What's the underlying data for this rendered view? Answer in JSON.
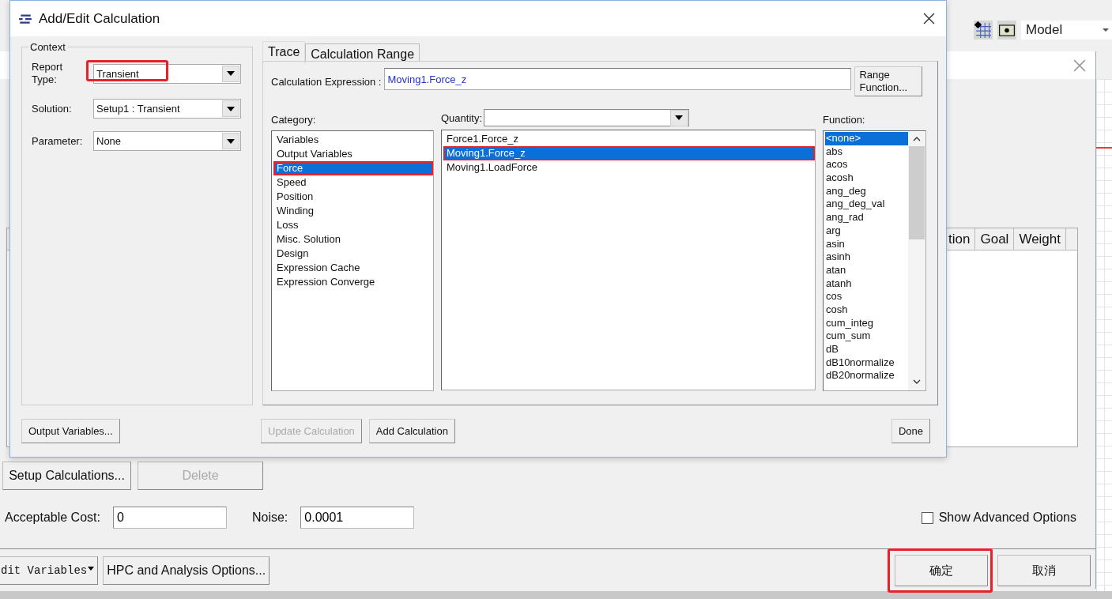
{
  "app": {
    "view_dropdown": "Model"
  },
  "setup_window": {
    "table": {
      "columns": [
        "tion",
        "Goal",
        "Weight"
      ]
    },
    "actions": [
      {
        "label": "Setup Calculations...",
        "disabled": false
      },
      {
        "label": "Delete",
        "disabled": true
      }
    ],
    "fields": [
      {
        "label": "Acceptable Cost:",
        "value": "0"
      },
      {
        "label": "Noise:",
        "value": "0.0001"
      }
    ],
    "advanced_option": {
      "label": "Show Advanced Options",
      "checked": false
    },
    "footer_buttons": [
      {
        "label": "dit Variables",
        "kind": "menu"
      },
      {
        "label": "HPC and Analysis Options...",
        "kind": "plain"
      }
    ],
    "dialog_buttons": [
      {
        "label": "确定",
        "highlighted": true
      },
      {
        "label": "取消",
        "highlighted": false
      }
    ]
  },
  "dialog": {
    "title": "Add/Edit Calculation",
    "context": {
      "legend": "Context",
      "fields": [
        {
          "label": "Report Type:",
          "value": "Transient",
          "highlighted": true
        },
        {
          "label": "Solution:",
          "value": "Setup1 : Transient",
          "highlighted": false
        },
        {
          "label": "Parameter:",
          "value": "None",
          "highlighted": false
        }
      ]
    },
    "output_variables_button": "Output Variables...",
    "tabs": [
      {
        "label": "Trace",
        "selected": true
      },
      {
        "label": "Calculation Range",
        "selected": false
      }
    ],
    "expression": {
      "label": "Calculation Expression :",
      "value": "Moving1.Force_z"
    },
    "range_function_button": "Range Function...",
    "category": {
      "label": "Category:",
      "items": [
        {
          "label": "Variables",
          "selected": false,
          "highlighted": false
        },
        {
          "label": "Output Variables",
          "selected": false,
          "highlighted": false
        },
        {
          "label": "Force",
          "selected": true,
          "highlighted": true
        },
        {
          "label": "Speed",
          "selected": false,
          "highlighted": false
        },
        {
          "label": "Position",
          "selected": false,
          "highlighted": false
        },
        {
          "label": "Winding",
          "selected": false,
          "highlighted": false
        },
        {
          "label": "Loss",
          "selected": false,
          "highlighted": false
        },
        {
          "label": "Misc. Solution",
          "selected": false,
          "highlighted": false
        },
        {
          "label": "Design",
          "selected": false,
          "highlighted": false
        },
        {
          "label": "Expression Cache",
          "selected": false,
          "highlighted": false
        },
        {
          "label": "Expression Converge",
          "selected": false,
          "highlighted": false
        }
      ]
    },
    "quantity": {
      "label": "Quantity:",
      "items": [
        {
          "label": "Force1.Force_z",
          "selected": false,
          "highlighted": false
        },
        {
          "label": "Moving1.Force_z",
          "selected": true,
          "highlighted": true
        },
        {
          "label": "Moving1.LoadForce",
          "selected": false,
          "highlighted": false
        }
      ]
    },
    "function": {
      "label": "Function:",
      "items": [
        {
          "label": "<none>",
          "selected": true
        },
        {
          "label": "abs",
          "selected": false
        },
        {
          "label": "acos",
          "selected": false
        },
        {
          "label": "acosh",
          "selected": false
        },
        {
          "label": "ang_deg",
          "selected": false
        },
        {
          "label": "ang_deg_val",
          "selected": false
        },
        {
          "label": "ang_rad",
          "selected": false
        },
        {
          "label": "arg",
          "selected": false
        },
        {
          "label": "asin",
          "selected": false
        },
        {
          "label": "asinh",
          "selected": false
        },
        {
          "label": "atan",
          "selected": false
        },
        {
          "label": "atanh",
          "selected": false
        },
        {
          "label": "cos",
          "selected": false
        },
        {
          "label": "cosh",
          "selected": false
        },
        {
          "label": "cum_integ",
          "selected": false
        },
        {
          "label": "cum_sum",
          "selected": false
        },
        {
          "label": "dB",
          "selected": false
        },
        {
          "label": "dB10normalize",
          "selected": false
        },
        {
          "label": "dB20normalize",
          "selected": false
        }
      ]
    },
    "buttons": [
      {
        "label": "Update Calculation",
        "disabled": true
      },
      {
        "label": "Add Calculation",
        "disabled": false
      },
      {
        "label": "Done",
        "disabled": false
      }
    ]
  }
}
